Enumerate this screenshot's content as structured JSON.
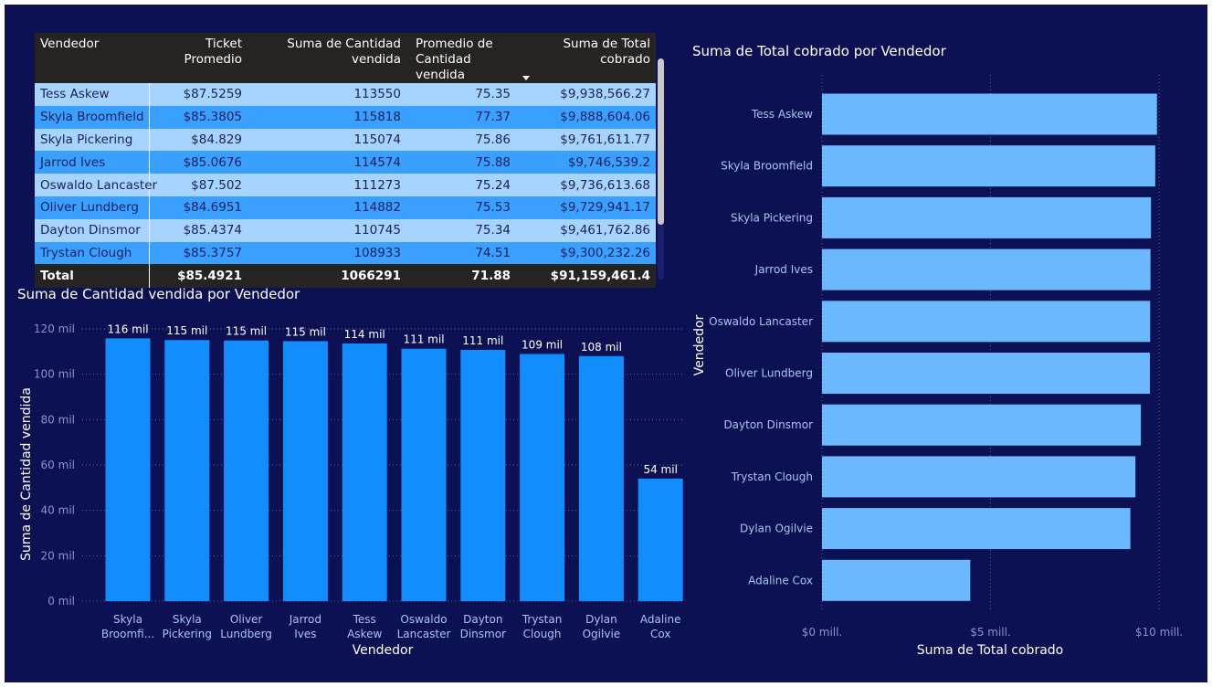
{
  "table": {
    "headers": [
      "Vendedor",
      "Ticket Promedio",
      "Suma de Cantidad vendida",
      "Promedio de Cantidad vendida",
      "Suma de Total cobrado"
    ],
    "header_lines": {
      "promedio_1": "Promedio de",
      "promedio_2": "Cantidad vendida"
    },
    "rows": [
      [
        "Tess Askew",
        "$87.5259",
        "113550",
        "75.35",
        "$9,938,566.27"
      ],
      [
        "Skyla Broomfield",
        "$85.3805",
        "115818",
        "77.37",
        "$9,888,604.06"
      ],
      [
        "Skyla Pickering",
        "$84.829",
        "115074",
        "75.86",
        "$9,761,611.77"
      ],
      [
        "Jarrod Ives",
        "$85.0676",
        "114574",
        "75.88",
        "$9,746,539.2"
      ],
      [
        "Oswaldo Lancaster",
        "$87.502",
        "111273",
        "75.24",
        "$9,736,613.68"
      ],
      [
        "Oliver Lundberg",
        "$84.6951",
        "114882",
        "75.53",
        "$9,729,941.17"
      ],
      [
        "Dayton Dinsmor",
        "$85.4374",
        "110745",
        "75.34",
        "$9,461,762.86"
      ],
      [
        "Trystan Clough",
        "$85.3757",
        "108933",
        "74.51",
        "$9,300,232.26"
      ]
    ],
    "total": [
      "Total",
      "$85.4921",
      "1066291",
      "71.88",
      "$91,159,461.4"
    ],
    "sorted_column": "Suma de Total cobrado",
    "sort_direction": "descending"
  },
  "colors": {
    "background": "#0c1154",
    "bar_vertical": "#118dff",
    "bar_horizontal": "#6bb8ff",
    "table_header": "#252423"
  },
  "chart_data": [
    {
      "type": "bar",
      "orientation": "vertical",
      "title": "Suma de Cantidad vendida por Vendedor",
      "xlabel": "Vendedor",
      "ylabel": "Suma de Cantidad vendida",
      "categories": [
        [
          "Skyla",
          "Broomfi..."
        ],
        [
          "Skyla",
          "Pickering"
        ],
        [
          "Oliver",
          "Lundberg"
        ],
        [
          "Jarrod",
          "Ives"
        ],
        [
          "Tess",
          "Askew"
        ],
        [
          "Oswaldo",
          "Lancaster"
        ],
        [
          "Dayton",
          "Dinsmor"
        ],
        [
          "Trystan",
          "Clough"
        ],
        [
          "Dylan",
          "Ogilvie"
        ],
        [
          "Adaline",
          "Cox"
        ]
      ],
      "values": [
        115818,
        115074,
        114882,
        114574,
        113550,
        111273,
        110745,
        108933,
        108000,
        54000
      ],
      "data_labels": [
        "116 mil",
        "115 mil",
        "115 mil",
        "115 mil",
        "114 mil",
        "111 mil",
        "111 mil",
        "109 mil",
        "108 mil",
        "54 mil"
      ],
      "yticks": [
        0,
        20000,
        40000,
        60000,
        80000,
        100000,
        120000
      ],
      "ytick_labels": [
        "0 mil",
        "20 mil",
        "40 mil",
        "60 mil",
        "80 mil",
        "100 mil",
        "120 mil"
      ],
      "ylim": [
        0,
        120000
      ],
      "grid": true
    },
    {
      "type": "bar",
      "orientation": "horizontal",
      "title": "Suma de Total cobrado por Vendedor",
      "xlabel": "Suma de Total cobrado",
      "ylabel": "Vendedor",
      "categories": [
        "Tess Askew",
        "Skyla Broomfield",
        "Skyla Pickering",
        "Jarrod Ives",
        "Oswaldo Lancaster",
        "Oliver Lundberg",
        "Dayton Dinsmor",
        "Trystan Clough",
        "Dylan Ogilvie",
        "Adaline Cox"
      ],
      "values": [
        9938566.27,
        9888604.06,
        9761611.77,
        9746539.2,
        9736613.68,
        9729941.17,
        9461762.86,
        9300232.26,
        9150000,
        4400000
      ],
      "xticks": [
        0,
        5000000,
        10000000
      ],
      "xtick_labels": [
        "$0 mill.",
        "$5 mill.",
        "$10 mill."
      ],
      "xlim": [
        0,
        10000000
      ],
      "grid": true
    }
  ]
}
